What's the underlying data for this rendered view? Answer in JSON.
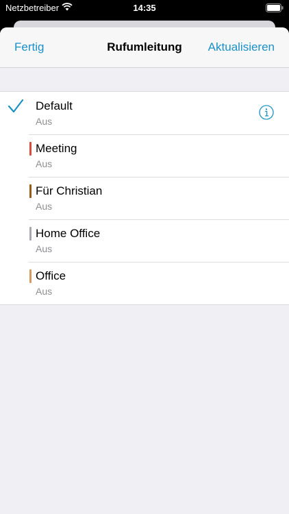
{
  "status": {
    "carrier": "Netzbetreiber",
    "time": "14:35",
    "icons": [
      "wifi-icon",
      "battery-icon"
    ]
  },
  "navbar": {
    "left_label": "Fertig",
    "title": "Rufumleitung",
    "right_label": "Aktualisieren"
  },
  "colors": {
    "accent": "#1a91c6",
    "secondary_text": "#8e8e93",
    "background": "#efeff4"
  },
  "rows": [
    {
      "title": "Default",
      "subtitle": "Aus",
      "selected": true,
      "color": null,
      "icon": "info-icon"
    },
    {
      "title": "Meeting",
      "subtitle": "Aus",
      "selected": false,
      "color": "#d94a3c"
    },
    {
      "title": "Für Christian",
      "subtitle": "Aus",
      "selected": false,
      "color": "#9a5a12"
    },
    {
      "title": "Home Office",
      "subtitle": "Aus",
      "selected": false,
      "color": "#a7a7ad"
    },
    {
      "title": "Office",
      "subtitle": "Aus",
      "selected": false,
      "color": "#d59a5e"
    }
  ]
}
